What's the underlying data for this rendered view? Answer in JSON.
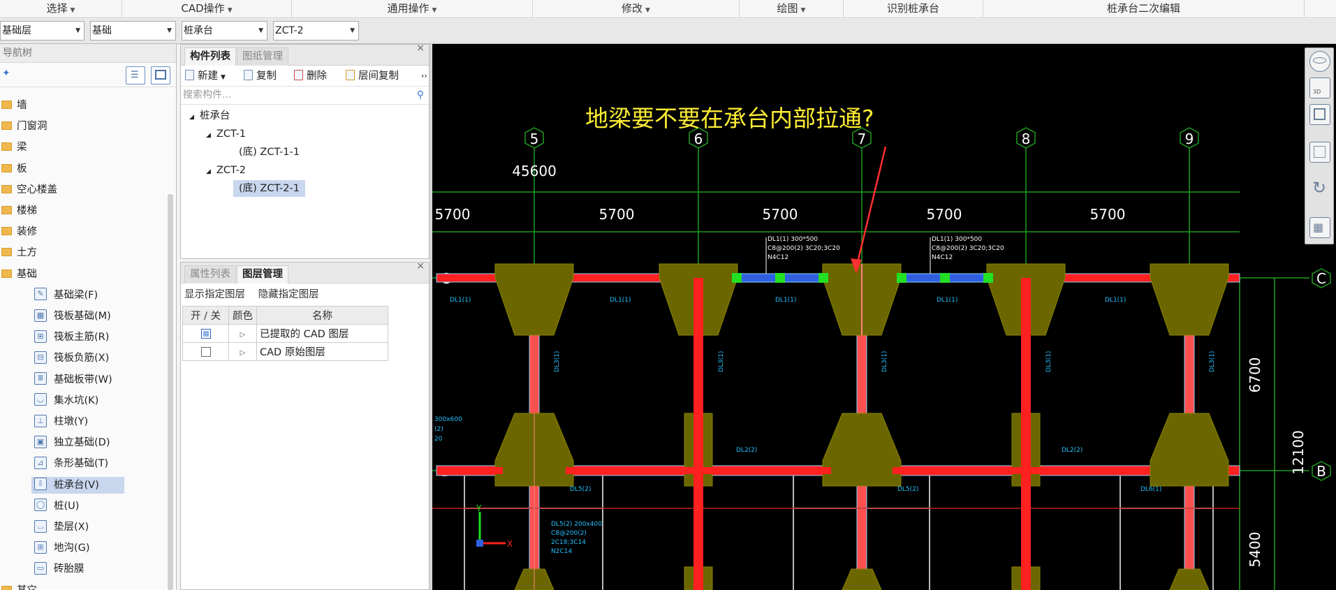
{
  "menubar": {
    "items": [
      {
        "label": "选择",
        "caret": true
      },
      {
        "label": "CAD操作",
        "caret": true
      },
      {
        "label": "通用操作",
        "caret": true
      },
      {
        "label": "修改",
        "caret": true
      },
      {
        "label": "绘图",
        "caret": true
      },
      {
        "label": "识别桩承台",
        "caret": false
      },
      {
        "label": "桩承台二次编辑",
        "caret": false
      }
    ]
  },
  "selectors": {
    "floor": "基础层",
    "category": "基础",
    "type": "桩承台",
    "component": "ZCT-2"
  },
  "nav": {
    "title": "导航树",
    "items": [
      {
        "label": "墙",
        "kind": "folder"
      },
      {
        "label": "门窗洞",
        "kind": "folder"
      },
      {
        "label": "梁",
        "kind": "folder"
      },
      {
        "label": "板",
        "kind": "folder"
      },
      {
        "label": "空心楼盖",
        "kind": "folder"
      },
      {
        "label": "楼梯",
        "kind": "folder"
      },
      {
        "label": "装修",
        "kind": "folder"
      },
      {
        "label": "土方",
        "kind": "folder"
      },
      {
        "label": "基础",
        "kind": "folder"
      },
      {
        "label": "基础梁(F)",
        "kind": "sub",
        "icon": "foundation-beam-icon"
      },
      {
        "label": "筏板基础(M)",
        "kind": "sub",
        "icon": "raft-foundation-icon"
      },
      {
        "label": "筏板主筋(R)",
        "kind": "sub",
        "icon": "raft-main-rebar-icon"
      },
      {
        "label": "筏板负筋(X)",
        "kind": "sub",
        "icon": "raft-negative-rebar-icon"
      },
      {
        "label": "基础板带(W)",
        "kind": "sub",
        "icon": "foundation-strip-icon"
      },
      {
        "label": "集水坑(K)",
        "kind": "sub",
        "icon": "sump-pit-icon"
      },
      {
        "label": "柱墩(Y)",
        "kind": "sub",
        "icon": "column-pier-icon"
      },
      {
        "label": "独立基础(D)",
        "kind": "sub",
        "icon": "isolated-footing-icon"
      },
      {
        "label": "条形基础(T)",
        "kind": "sub",
        "icon": "strip-footing-icon"
      },
      {
        "label": "桩承台(V)",
        "kind": "sub",
        "icon": "pile-cap-icon",
        "active": true
      },
      {
        "label": "桩(U)",
        "kind": "sub",
        "icon": "pile-icon"
      },
      {
        "label": "垫层(X)",
        "kind": "sub",
        "icon": "cushion-layer-icon"
      },
      {
        "label": "地沟(G)",
        "kind": "sub",
        "icon": "trench-icon"
      },
      {
        "label": "砖胎膜",
        "kind": "sub",
        "icon": "brick-mold-icon"
      },
      {
        "label": "其它",
        "kind": "folder"
      }
    ]
  },
  "components": {
    "tabs": [
      "构件列表",
      "图纸管理"
    ],
    "toolbar": {
      "new": "新建",
      "copy": "复制",
      "delete": "删除",
      "floor_copy": "层间复制"
    },
    "search_placeholder": "搜索构件...",
    "tree": {
      "root": "桩承台",
      "groups": [
        {
          "name": "ZCT-1",
          "child": "(底) ZCT-1-1"
        },
        {
          "name": "ZCT-2",
          "child": "(底) ZCT-2-1"
        }
      ]
    }
  },
  "layers": {
    "tabs": [
      "属性列表",
      "图层管理"
    ],
    "show_specified": "显示指定图层",
    "hide_specified": "隐藏指定图层",
    "headers": [
      "开 / 关",
      "颜色",
      "名称"
    ],
    "rows": [
      {
        "on": true,
        "name": "已提取的 CAD 图层"
      },
      {
        "on": false,
        "name": "CAD 原始图层"
      }
    ]
  },
  "cad": {
    "question": "地梁要不要在承台内部拉通?",
    "axes_top": [
      "5",
      "6",
      "7",
      "8",
      "9"
    ],
    "axes_side": [
      "C",
      "B"
    ],
    "total_dim": "45600",
    "spans": [
      "5700",
      "5700",
      "5700",
      "5700",
      "5700"
    ],
    "right_dims": [
      "6700",
      "12100",
      "5400"
    ],
    "beam_labels_top": [
      "DL1(1)",
      "DL1(1)",
      "DL1(1)",
      "DL1(1)",
      "DL1(1)"
    ],
    "beam_labels_vert": [
      "DL3(1)",
      "DL3(1)",
      "DL3(1)",
      "DL3(1)",
      "DL3(1)"
    ],
    "beam_labels_mid": [
      "DL2(2)",
      "DL2(2)"
    ],
    "beam_labels_low": [
      "DL5(2)",
      "DL5(2)",
      "DL6(1)"
    ],
    "annotation_a": [
      "DL1(1) 300*500",
      "C8@200(2) 3C20;3C20",
      "N4C12"
    ],
    "annotation_b": [
      "DL1(1) 300*500",
      "C8@200(2) 3C20;3C20",
      "N4C12"
    ],
    "left_note": [
      "300x600",
      "(2)",
      "20"
    ],
    "low_note": [
      "DL5(2) 200x400",
      "C8@200(2)",
      "2C18;3C14",
      "N2C14"
    ],
    "ucs": {
      "x": "X",
      "y": "Y"
    }
  },
  "colors": {
    "beam_red": "#ff2020",
    "beam_blue": "#2f5fe0",
    "grip_green": "#22e022",
    "pile_cap": "#6b6600",
    "axis_green": "#1f9c1f",
    "annotation_yellow": "#ffee33"
  }
}
